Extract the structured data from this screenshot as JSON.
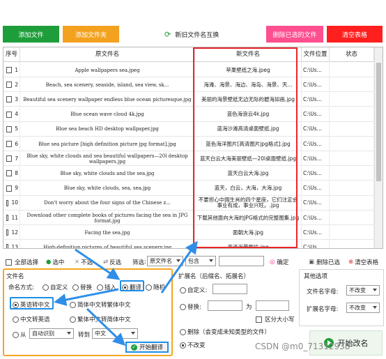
{
  "toolbar": {
    "add_file": "添加文件",
    "add_folder": "添加文件夹",
    "swap": "新旧文件名互换",
    "delete_selected": "删除已选的文件",
    "clear_table": "清空表格"
  },
  "colors": {
    "green": "#1e9e3a",
    "orange": "#f3a21f",
    "pink": "#ff4f8f",
    "red": "#ff1f1f",
    "accent_red": "#e8262b",
    "accent_blue": "#1e8ee6",
    "accent_orange": "#f5a623"
  },
  "table": {
    "headers": [
      "序号",
      "原文件名",
      "新文件名",
      "文件位置",
      "状态"
    ],
    "rows": [
      {
        "n": "1",
        "orig": "Apple wallpapers sea.jpeg",
        "new": "苹果壁纸之海.jpeg",
        "loc": "C:\\Us..."
      },
      {
        "n": "2",
        "orig": "Beach, sea scenery, seaside, island, sea view, sk...",
        "new": "海滩、海景、海边、海岛、海景、天...",
        "loc": "C:\\Us..."
      },
      {
        "n": "3",
        "orig": "Beautiful sea scenery wallpaper endless blue ocean picturesque.jpg",
        "new": "美丽的海景壁纸无边无际的碧海如画.jpg",
        "loc": "C:\\Us..."
      },
      {
        "n": "4",
        "orig": "Blue ocean wave cloud 4k.jpg",
        "new": "蓝色海浪云4k.jpg",
        "loc": "C:\\Us..."
      },
      {
        "n": "5",
        "orig": "Blue sea beach HD desktop wallpaper.jpg",
        "new": "蓝海沙滩高清桌面壁纸.jpg",
        "loc": "C:\\Us..."
      },
      {
        "n": "6",
        "orig": "Blue sea picture [high definition picture jpg format].jpg",
        "new": "蓝色海洋图片[高清图片jpg格式].jpg",
        "loc": "C:\\Us..."
      },
      {
        "n": "7",
        "orig": "Blue sky, white clouds and sea beautiful wallpapers—20l desktop wallpapers.jpg",
        "new": "蓝天白云大海美丽壁纸—20l桌面壁纸.jpg",
        "loc": "C:\\Us..."
      },
      {
        "n": "8",
        "orig": "Blue sky, white clouds and the sea.jpg",
        "new": "蓝天白云大海.jpg",
        "loc": "C:\\Us..."
      },
      {
        "n": "9",
        "orig": "Blue sky, white clouds, sea, sea.jpg",
        "new": "蓝天，白云，大海，大海.jpg",
        "loc": "C:\\Us..."
      },
      {
        "n": "10",
        "orig": "Don't worry about the four signs of the Chinese z...",
        "new": "不要担心中国生肖的四个星座，它们注定会事业有成，事业兴旺。.jpg",
        "loc": "C:\\Us..."
      },
      {
        "n": "11",
        "orig": "Download other complete books of pictures facing the sea in JPG format.jpg",
        "new": "下载其他面向大海的JPG格式的完整图集.jpg",
        "loc": "C:\\Us..."
      },
      {
        "n": "12",
        "orig": "Facing the sea.jpg",
        "new": "面朝大海.jpg",
        "loc": "C:\\Us..."
      },
      {
        "n": "13",
        "orig": "High-definition pictures of beautiful sea scenery.jpg",
        "new": "高清海景图片.jpg",
        "loc": "C:\\Us..."
      }
    ]
  },
  "actionbar": {
    "select_all": "全部选择",
    "select": "选中",
    "unselect": "不选",
    "invert": "反选",
    "filter": "筛选",
    "filter_field": "原文件名",
    "filter_op": "包含",
    "confirm": "确定",
    "delete_checked": "删除已选",
    "clear_list": "清空表格"
  },
  "filename_panel": {
    "title": "文件名",
    "naming_label": "命名方式:",
    "opts": [
      "自定义",
      "替换",
      "插入",
      "翻译",
      "随机"
    ],
    "translate_opts": [
      "英语转中文",
      "简体中文转繁体中文",
      "中文转英语",
      "繁体中文转简体中文"
    ],
    "from_label": "从",
    "from_value": "自动识别",
    "to_label": "转到",
    "to_value": "中文",
    "start_btn": "开始翻译"
  },
  "ext_panel": {
    "title": "扩展名（后缀名、拓展名）",
    "custom": "自定义:",
    "replace": "替换:",
    "as": "为",
    "case": "区分大小写",
    "delete": "删除（会变成未知类型的文件）",
    "no_change": "不改变"
  },
  "other_panel": {
    "title": "其他选项",
    "fname_case_label": "文件名字母:",
    "fname_case_value": "不改变",
    "ext_case_label": "扩展名字母:",
    "ext_case_value": "不改变"
  },
  "start_rename": "开始改名",
  "watermark": "CSDN @m0_71312938"
}
